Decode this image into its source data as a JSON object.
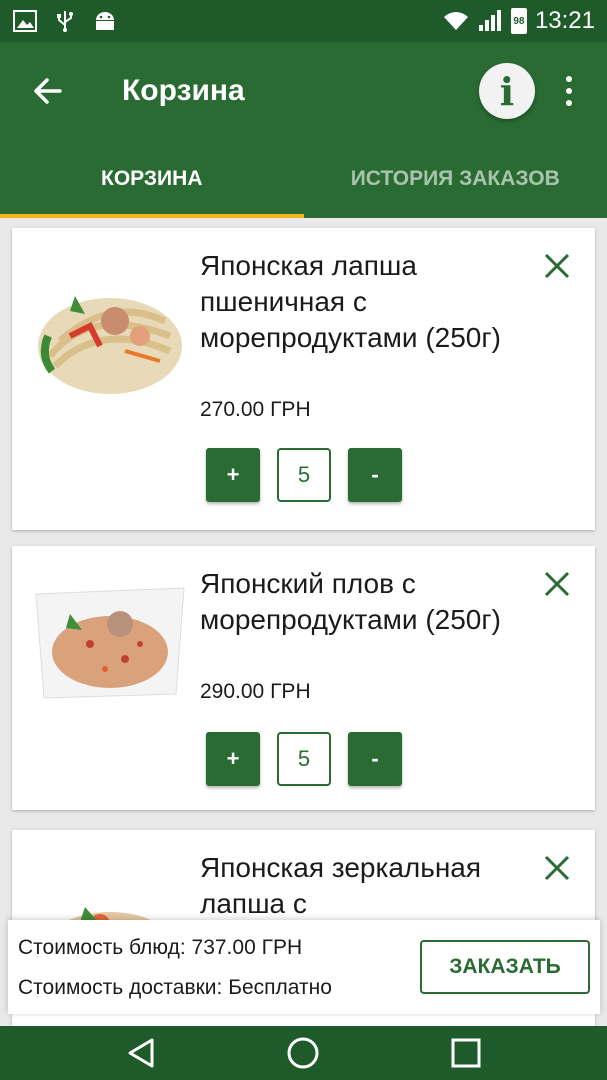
{
  "status_bar": {
    "battery": "98",
    "time": "13:21",
    "left_icons": [
      "image-icon",
      "usb-icon",
      "android-icon"
    ],
    "right_icons": [
      "wifi-icon",
      "signal-icon",
      "battery-icon"
    ]
  },
  "app_bar": {
    "title": "Корзина",
    "back_icon": "arrow-left-icon",
    "info_label": "i",
    "more_icon": "more-vert-icon"
  },
  "tabs": [
    {
      "label": "КОРЗИНА",
      "active": true
    },
    {
      "label": "ИСТОРИЯ ЗАКАЗОВ",
      "active": false
    }
  ],
  "cart": {
    "items": [
      {
        "name": "Японская лапша пшеничная с морепродуктами (250г)",
        "price": "270.00 ГРН",
        "quantity": "5",
        "plus_label": "+",
        "minus_label": "-"
      },
      {
        "name": "Японский плов с морепродуктами (250г)",
        "price": "290.00 ГРН",
        "quantity": "5",
        "plus_label": "+",
        "minus_label": "-"
      },
      {
        "name": "Японская зеркальная лапша с",
        "price": "",
        "quantity": "",
        "plus_label": "+",
        "minus_label": "-"
      }
    ]
  },
  "summary": {
    "dishes_cost": "Стоимость блюд: 737.00 ГРН",
    "delivery_cost": "Стоимость доставки: Бесплатно",
    "order_button": "ЗАКАЗАТЬ"
  },
  "nav_bar": {
    "icons": [
      "back-triangle-icon",
      "home-circle-icon",
      "recents-square-icon"
    ]
  },
  "colors": {
    "primary": "#2a6b33",
    "status": "#1e5a2a",
    "accent": "#f2b51d"
  }
}
